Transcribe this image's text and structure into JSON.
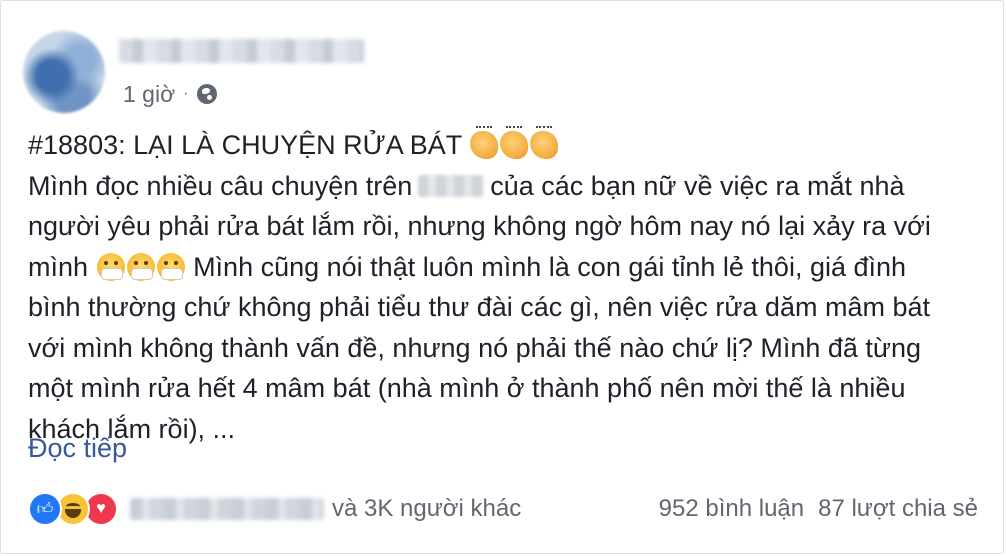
{
  "post": {
    "timestamp": "1 giờ",
    "separator": "·",
    "lines": [
      {
        "text": "#18803: LẠI LÀ CHUYỆN RỬA BÁT",
        "emoji": [
          "clap-emoji",
          "clap-emoji",
          "clap-emoji"
        ]
      },
      {
        "before": "Mình đọc nhiều câu chuyện trên",
        "after": "của các bạn nữ về việc ra mắt nhà"
      },
      {
        "text": "người yêu phải rửa bát lắm rồi, nhưng không ngờ hôm nay nó lại xảy ra với"
      },
      {
        "before": "mình",
        "after": "Mình cũng nói thật luôn mình là con gái tỉnh lẻ thôi, giá đình"
      },
      {
        "text": "bình thường chứ không phải tiểu thư đài các gì, nên việc rửa dăm mâm bát"
      },
      {
        "text": "với mình không thành vấn đề, nhưng nó phải thế nào chứ lị? Mình đã từng"
      },
      {
        "text": "một mình rửa hết 4 mâm bát (nhà mình ở thành phố nên mời thế là nhiều"
      },
      {
        "text": "khách lắm rồi), ..."
      }
    ],
    "see_more": "Đọc tiếp"
  },
  "footer": {
    "reactions": [
      "like-icon",
      "haha-icon",
      "love-icon"
    ],
    "others": "và 3K người khác",
    "comments": "952 bình luận",
    "shares": "87 lượt chia sẻ"
  },
  "colors": {
    "link": "#385898",
    "meta_text": "#616770",
    "body_text": "#1d2129",
    "like": "#2078f4",
    "love": "#f0384c",
    "haha": "#f7c437"
  }
}
